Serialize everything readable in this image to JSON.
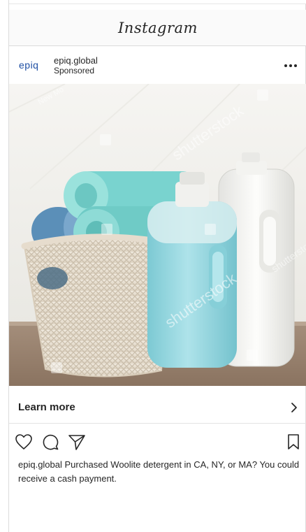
{
  "app": {
    "title": "Instagram"
  },
  "post": {
    "account": {
      "logo_text": "epiq",
      "username": "epiq.global",
      "sponsored_label": "Sponsored"
    },
    "more_label": "···",
    "cta": {
      "label": "Learn more",
      "chevron": "›"
    },
    "caption": {
      "username": "epiq.global",
      "text": "Purchased Woolite detergent in CA, NY, or MA? You could receive a cash payment."
    },
    "media_watermarks": [
      "shutterstock",
      "shutterstock",
      "New Mo",
      "shutterstock"
    ],
    "icons": [
      "more-horizontal-icon",
      "heart-icon",
      "comment-icon",
      "share-icon",
      "bookmark-icon",
      "chevron-right-icon"
    ]
  },
  "colors": {
    "brand_blue": "#1f4fa3",
    "text": "#262626",
    "detergent_blue": "#8fd6df",
    "towel_teal": "#79d3cf"
  }
}
